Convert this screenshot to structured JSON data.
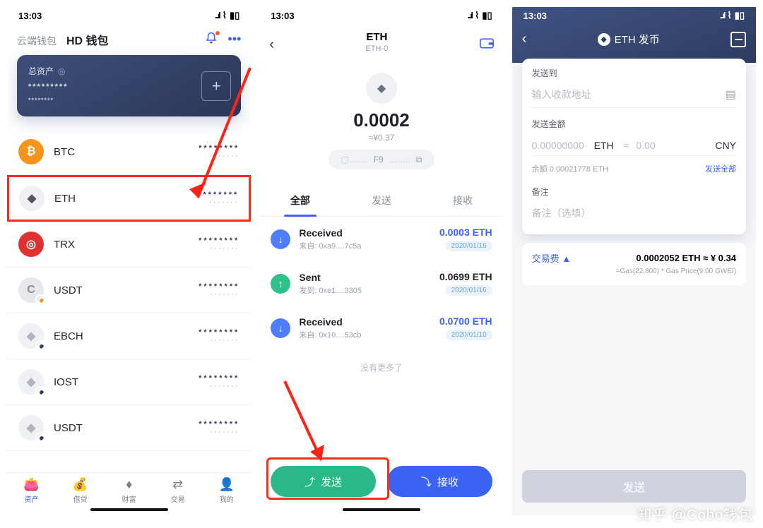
{
  "colors": {
    "accent": "#3a63f3",
    "danger": "#ff2a16",
    "send": "#29b888"
  },
  "s1": {
    "time": "13:03",
    "tabs": {
      "cloud": "云端钱包",
      "hd": "HD 钱包"
    },
    "card": {
      "label": "总资产",
      "masked1": "*********",
      "masked2": "********"
    },
    "coins": [
      {
        "sym": "BTC",
        "ic_bg": "#f7931a",
        "ic_fg": "#fff",
        "glyph": "₿",
        "sub": false
      },
      {
        "sym": "ETH",
        "ic_bg": "#eef0f4",
        "ic_fg": "#555",
        "glyph": "◆",
        "sub": false,
        "highlight": true
      },
      {
        "sym": "TRX",
        "ic_bg": "#e03131",
        "ic_fg": "#fff",
        "glyph": "◎",
        "sub": false
      },
      {
        "sym": "USDT",
        "ic_bg": "#e6e8ec",
        "ic_fg": "#8a8f99",
        "glyph": "C",
        "sub": true,
        "sub_color": "#f7931a"
      },
      {
        "sym": "EBCH",
        "ic_bg": "#eef0f4",
        "ic_fg": "#b0b4bd",
        "glyph": "◆",
        "sub": true,
        "sub_color": "#2f3c60"
      },
      {
        "sym": "IOST",
        "ic_bg": "#eef0f4",
        "ic_fg": "#b0b4bd",
        "glyph": "◆",
        "sub": true,
        "sub_color": "#2f3c60"
      },
      {
        "sym": "USDT",
        "ic_bg": "#eef0f4",
        "ic_fg": "#b0b4bd",
        "glyph": "◆",
        "sub": true,
        "sub_color": "#2f3c60"
      }
    ],
    "masked_bal": "********",
    "masked_sub": "·······",
    "tabs_bottom": [
      {
        "label": "资产",
        "glyph": "👛",
        "active": true
      },
      {
        "label": "借贷",
        "glyph": "💰"
      },
      {
        "label": "财富",
        "glyph": "♦"
      },
      {
        "label": "交易",
        "glyph": "⇄"
      },
      {
        "label": "我的",
        "glyph": "👤"
      }
    ]
  },
  "s2": {
    "time": "13:03",
    "title": "ETH",
    "subtitle": "ETH-0",
    "balance": "0.0002",
    "approx": "≈¥0.37",
    "addr_mid": "F9",
    "txtabs": {
      "all": "全部",
      "send": "发送",
      "recv": "接收"
    },
    "tx": [
      {
        "dir": "in",
        "title": "Received",
        "sub": "来自: 0xa9....7c5a",
        "amt": "0.0003 ETH",
        "amt_color": "#3a63f3",
        "date": "2020/01/16"
      },
      {
        "dir": "out",
        "title": "Sent",
        "sub": "发到: 0xe1....3305",
        "amt": "0.0699 ETH",
        "amt_color": "#1d2027",
        "date": "2020/01/16"
      },
      {
        "dir": "in",
        "title": "Received",
        "sub": "来自: 0x10....53cb",
        "amt": "0.0700 ETH",
        "amt_color": "#3a63f3",
        "date": "2020/01/10"
      }
    ],
    "no_more": "没有更多了",
    "btn_send": "发送",
    "btn_recv": "接收"
  },
  "s3": {
    "time": "13:03",
    "title": "ETH 发币",
    "to_label": "发送到",
    "to_placeholder": "输入收款地址",
    "amount_label": "发送金额",
    "amount_placeholder": "0.00000000",
    "amount_sym": "ETH",
    "approx_sym": "≈",
    "fiat_placeholder": "0.00",
    "fiat_sym": "CNY",
    "balance_prefix": "余额",
    "balance_value": "0.00021778 ETH",
    "send_all": "发送全部",
    "memo_label": "备注",
    "memo_placeholder": "备注（选填）",
    "fee_label": "交易费 ▲",
    "fee_value": "0.0002052 ETH ≈ ¥ 0.34",
    "fee_sub": "=Gas(22,800) * Gas Price(9.00 GWEI)",
    "send_btn": "发送"
  },
  "watermark": "知乎 @Cobo钱包"
}
